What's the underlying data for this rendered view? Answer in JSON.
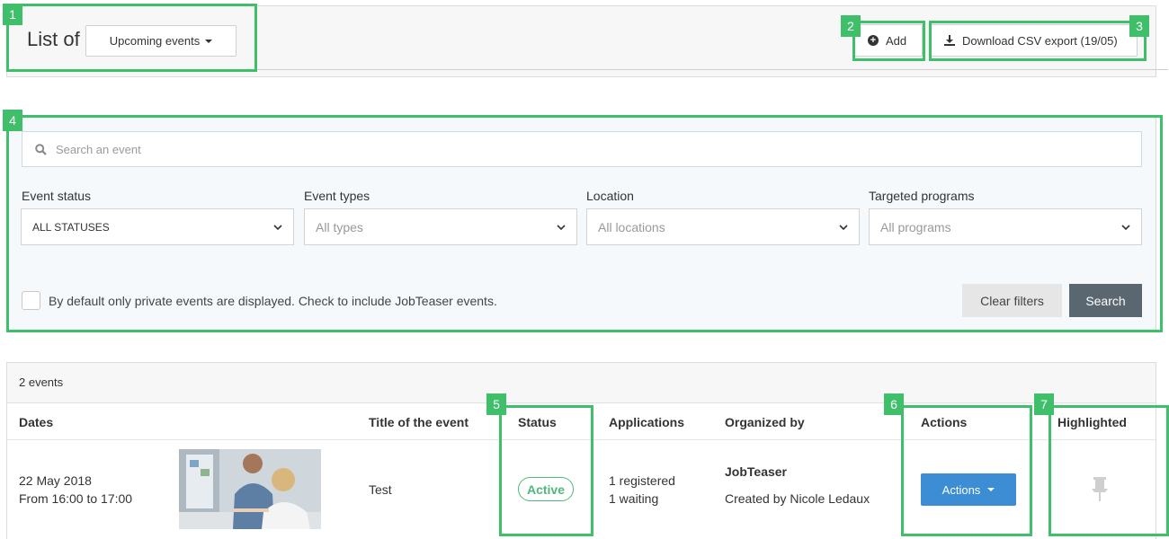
{
  "header": {
    "list_of_label": "List of",
    "period_selected": "Upcoming events",
    "add_label": "Add",
    "csv_label": "Download CSV export (19/05)"
  },
  "filters": {
    "search_placeholder": "Search an event",
    "event_status": {
      "label": "Event status",
      "value": "ALL STATUSES"
    },
    "event_types": {
      "label": "Event types",
      "value": "All types"
    },
    "location": {
      "label": "Location",
      "value": "All locations"
    },
    "targeted_programs": {
      "label": "Targeted programs",
      "value": "All programs"
    },
    "checkbox_label": "By default only private events are displayed. Check to include JobTeaser events.",
    "checkbox_checked": false,
    "clear_label": "Clear filters",
    "search_label": "Search"
  },
  "table": {
    "count": "2 events",
    "columns": {
      "dates": "Dates",
      "title": "Title of the event",
      "status": "Status",
      "applications": "Applications",
      "organized_by": "Organized by",
      "actions": "Actions",
      "highlighted": "Highlighted"
    },
    "rows": [
      {
        "date": "22 May 2018",
        "time": "From 16:00 to 17:00",
        "title": "Test",
        "status": "Active",
        "registered": "1 registered",
        "waiting": "1 waiting",
        "organizer": "JobTeaser",
        "created_by": "Created by Nicole Ledaux",
        "actions_label": "Actions"
      }
    ]
  },
  "annotations": [
    "1",
    "2",
    "3",
    "4",
    "5",
    "6",
    "7"
  ],
  "colors": {
    "highlight": "#3fbf6a",
    "active_status": "#4fb87a",
    "primary_button": "#3d8dd4",
    "search_button": "#5a6670"
  }
}
